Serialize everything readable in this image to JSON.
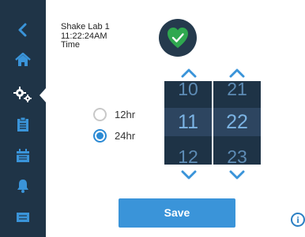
{
  "sidebar": {
    "items": [
      {
        "icon": "back-chevron-icon"
      },
      {
        "icon": "home-icon"
      },
      {
        "icon": "settings-gears-icon"
      },
      {
        "icon": "clipboard-icon"
      },
      {
        "icon": "calendar-icon"
      },
      {
        "icon": "bell-icon"
      },
      {
        "icon": "screen-icon"
      }
    ],
    "active_index": 2
  },
  "header": {
    "device_name": "Shake Lab 1",
    "current_time": "11:22:24AM",
    "section_title": "Time"
  },
  "status": {
    "icon": "shield-check-icon",
    "color": "#2fa84f"
  },
  "format": {
    "options": [
      {
        "label": "12hr",
        "selected": false
      },
      {
        "label": "24hr",
        "selected": true
      }
    ]
  },
  "time_picker": {
    "hours": {
      "prev": "10",
      "current": "11",
      "next": "12"
    },
    "minutes": {
      "prev": "21",
      "current": "22",
      "next": "23"
    }
  },
  "actions": {
    "save_label": "Save",
    "info_label": "i"
  },
  "colors": {
    "sidebar": "#1f3447",
    "accent": "#3a94d9",
    "spinner_bg": "#1e3346",
    "success": "#2fa84f"
  }
}
